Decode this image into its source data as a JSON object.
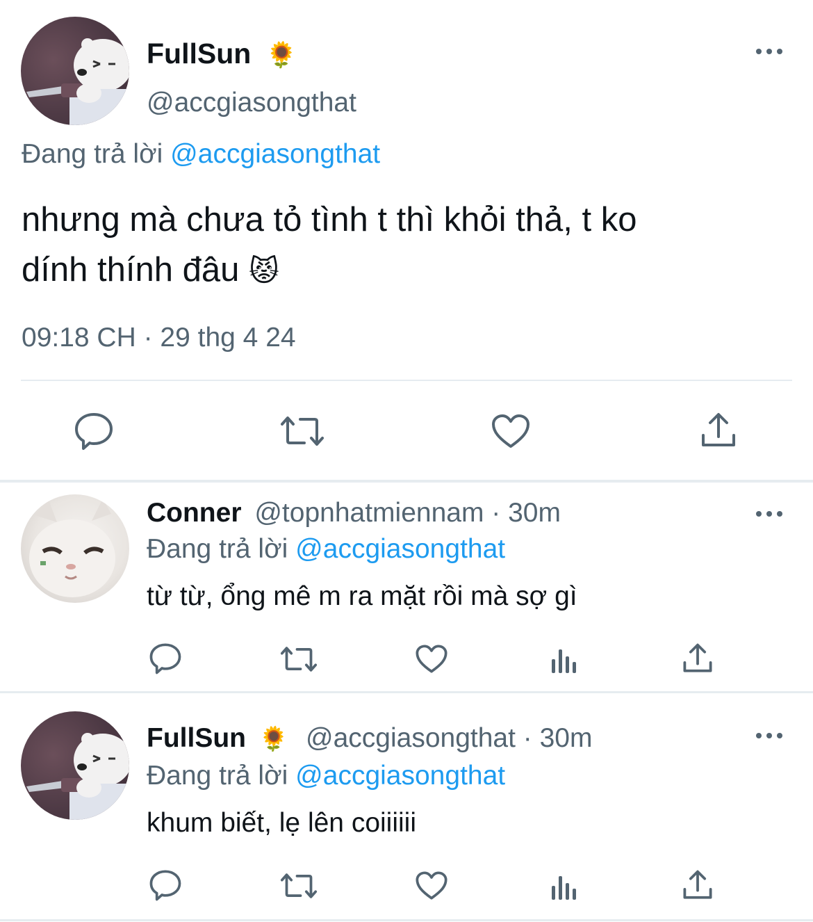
{
  "main_tweet": {
    "display_name": "FullSun",
    "name_emoji": "🌻",
    "handle": "@accgiasongthat",
    "replying_to_label": "Đang trả lời",
    "replying_to_handle": "@accgiasongthat",
    "text_line1": "nhưng mà chưa tỏ tình t thì khỏi thả, t ko",
    "text_line2": "dính thính đâu",
    "text_emoji": "😾",
    "timestamp": "09:18 CH · 29 thg 4 24",
    "actions": [
      "reply-icon",
      "retweet-icon",
      "like-icon",
      "share-icon"
    ]
  },
  "replies": [
    {
      "display_name": "Conner",
      "meta": "@topnhatmiennam · 30m",
      "replying_to_label": "Đang trả lời",
      "replying_to_handle": "@accgiasongthat",
      "text": "từ từ, ổng mê m ra mặt rồi mà sợ gì",
      "actions": [
        "reply-icon",
        "retweet-icon",
        "like-icon",
        "analytics-icon",
        "share-icon"
      ]
    },
    {
      "display_name": "FullSun",
      "name_emoji": "🌻",
      "meta": "@accgiasongthat · 30m",
      "replying_to_label": "Đang trả lời",
      "replying_to_handle": "@accgiasongthat",
      "text": "khum biết, lẹ lên coiiiiii",
      "actions": [
        "reply-icon",
        "retweet-icon",
        "like-icon",
        "analytics-icon",
        "share-icon"
      ]
    }
  ],
  "colors": {
    "text": "#0f1419",
    "secondary": "#536471",
    "link": "#1d9bf0",
    "divider": "#e6ecf0"
  }
}
